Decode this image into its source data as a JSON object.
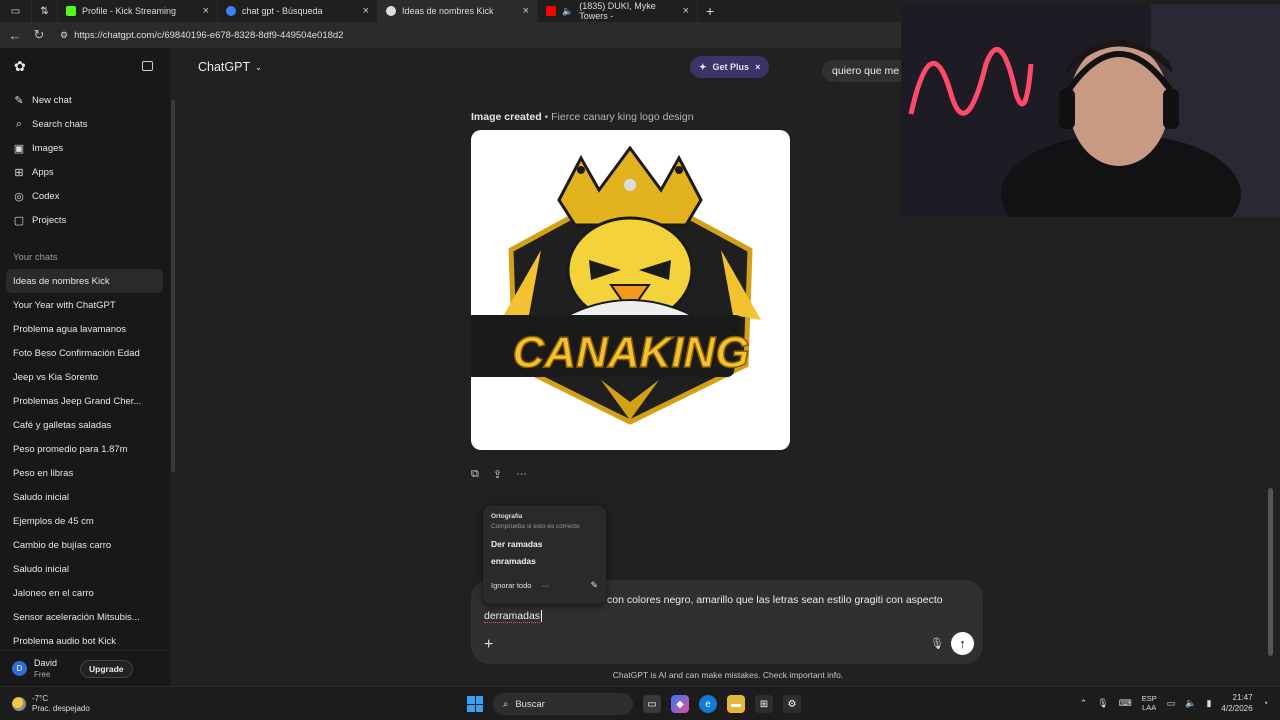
{
  "browser": {
    "tabs": [
      {
        "title": "Profile - Kick Streaming",
        "color": "#53fc18"
      },
      {
        "title": "chat gpt - Búsqueda",
        "color": "#3b82f6"
      },
      {
        "title": "Ideas de nombres Kick",
        "color": "#dddddd"
      },
      {
        "title": "(1835) DUKI, Myke Towers -",
        "color": "#ff0000"
      }
    ],
    "url": "https://chatgpt.com/c/69840196-e678-8328-8df9-449504e018d2"
  },
  "sidebar": {
    "nav": [
      {
        "label": "New chat",
        "icon": "new-chat-icon"
      },
      {
        "label": "Search chats",
        "icon": "search-icon"
      },
      {
        "label": "Images",
        "icon": "images-icon"
      },
      {
        "label": "Apps",
        "icon": "apps-icon"
      },
      {
        "label": "Codex",
        "icon": "codex-icon"
      },
      {
        "label": "Projects",
        "icon": "folder-icon"
      }
    ],
    "section_label": "Your chats",
    "chats": [
      "Ideas de nombres Kick",
      "Your Year with ChatGPT",
      "Problema agua lavamanos",
      "Foto Beso Confirmación Edad",
      "Jeep vs Kia Sorento",
      "Problemas Jeep Grand Cher...",
      "Café y galletas saladas",
      "Peso promedio para 1.87m",
      "Peso en libras",
      "Saludo inicial",
      "Ejemplos de 45 cm",
      "Cambio de bujías carro",
      "Saludo inicial",
      "Jaloneo en el carro",
      "Sensor aceleración Mitsubis...",
      "Problema audio bot Kick"
    ],
    "user": {
      "initial": "D",
      "name": "David",
      "plan": "Free",
      "upgrade_label": "Upgrade"
    }
  },
  "main": {
    "model_label": "ChatGPT",
    "get_plus_label": "Get Plus",
    "user_message_preview": "quiero que me",
    "image_created_label": "Image created",
    "image_title": "• Fierce canary king logo design",
    "logo_text": "CANAKING",
    "composer_text_line1": "con colores negro, amarillo que las letras sean estilo gragiti con aspecto",
    "composer_text_line2": "derramadas",
    "disclaimer": "ChatGPT is AI and can make mistakes. Check important info."
  },
  "spell_popup": {
    "heading": "Ortografía",
    "subheading": "Comprueba si esto es correcto",
    "suggestion1": "Der ramadas",
    "suggestion2": "enramadas",
    "ignore_label": "Ignorar todo"
  },
  "taskbar": {
    "temperature": "-7°C",
    "weather": "Prac. despejado",
    "search_label": "Buscar",
    "lang_top": "ESP",
    "lang_bottom": "LAA",
    "time": "21:47",
    "date": "4/2/2026"
  }
}
